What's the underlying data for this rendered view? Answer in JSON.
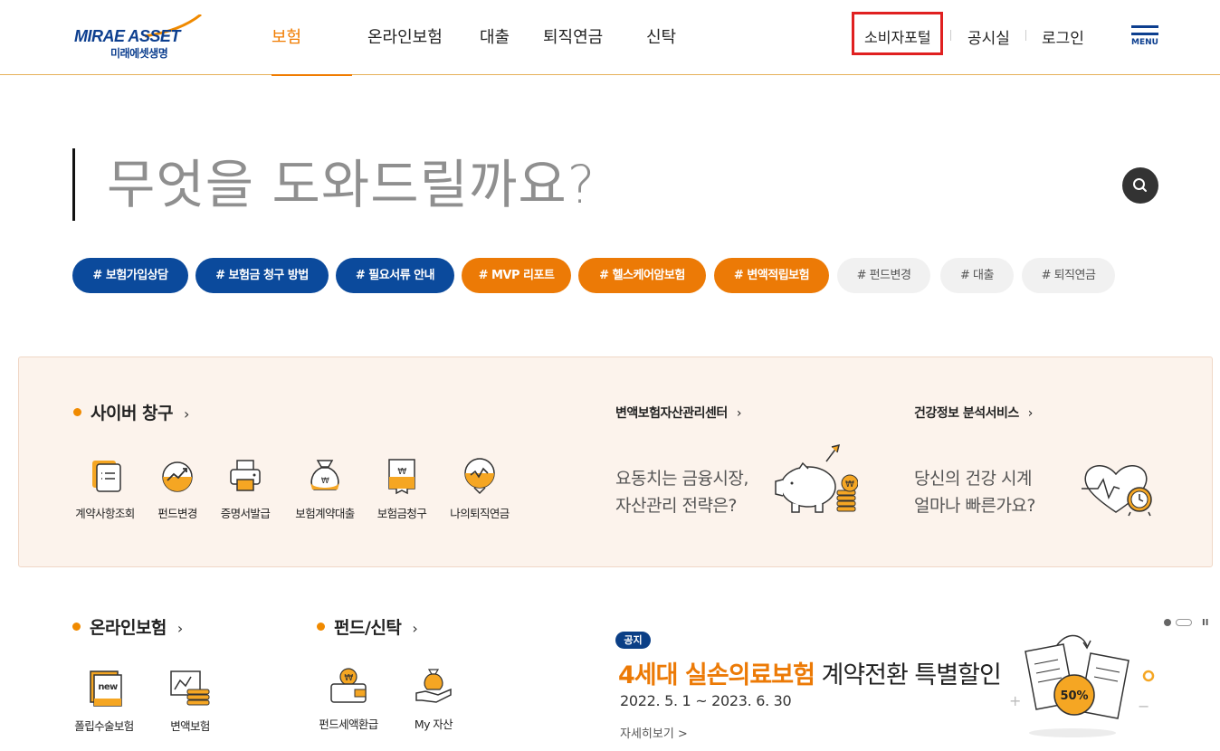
{
  "header": {
    "logo_brand": "MIRAE ASSET",
    "logo_sub": "미래에셋생명",
    "nav": [
      {
        "label": "보험",
        "active": true
      },
      {
        "label": "온라인보험",
        "active": false
      },
      {
        "label": "대출",
        "active": false
      },
      {
        "label": "퇴직연금",
        "active": false
      },
      {
        "label": "신탁",
        "active": false
      }
    ],
    "util": {
      "consumer": "소비자포털",
      "notice": "공시실",
      "login": "로그인"
    },
    "menu_label": "MENU"
  },
  "search": {
    "placeholder": "무엇을 도와드릴까요?"
  },
  "tags": [
    {
      "label": "# 보험가입상담",
      "style": "blue"
    },
    {
      "label": "# 보험금 청구 방법",
      "style": "blue"
    },
    {
      "label": "# 필요서류 안내",
      "style": "blue"
    },
    {
      "label": "# MVP 리포트",
      "style": "orange"
    },
    {
      "label": "# 헬스케어암보험",
      "style": "orange"
    },
    {
      "label": "# 변액적립보험",
      "style": "orange"
    },
    {
      "label": "# 펀드변경",
      "style": "gray"
    },
    {
      "label": "# 대출",
      "style": "gray"
    },
    {
      "label": "# 퇴직연금",
      "style": "gray"
    }
  ],
  "cyber": {
    "title": "사이버 창구",
    "services": [
      {
        "label": "계약사항조회",
        "icon": "contract-doc-icon"
      },
      {
        "label": "펀드변경",
        "icon": "fund-chart-icon"
      },
      {
        "label": "증명서발급",
        "icon": "printer-icon"
      },
      {
        "label": "보험계약대출",
        "icon": "money-bag-icon"
      },
      {
        "label": "보험금청구",
        "icon": "claim-doc-icon"
      },
      {
        "label": "나의퇴직연금",
        "icon": "pension-chart-icon"
      }
    ],
    "asset_center": {
      "title": "변액보험자산관리센터",
      "text_line1": "요동치는 금융시장,",
      "text_line2": "자산관리 전략은?"
    },
    "health": {
      "title": "건강정보 분석서비스",
      "text_line1": "당신의 건강 시계",
      "text_line2": "얼마나 빠른가요?"
    }
  },
  "online": {
    "title": "온라인보험",
    "services": [
      {
        "label": "폴립수술보험",
        "icon": "new-book-icon"
      },
      {
        "label": "변액보험",
        "icon": "chart-coins-icon"
      }
    ]
  },
  "fund": {
    "title": "펀드/신탁",
    "services": [
      {
        "label": "펀드세액환급",
        "icon": "wallet-icon"
      },
      {
        "label": "My 자산",
        "icon": "hand-money-icon"
      }
    ]
  },
  "notice": {
    "badge": "공지",
    "title_highlight": "4세대 실손의료보험",
    "title_rest": " 계약전환 특별할인",
    "date": "2022. 5. 1 ~ 2023. 6. 30",
    "more": "자세히보기 >",
    "discount": "50%"
  },
  "colors": {
    "brand_blue": "#0b4a9c",
    "brand_orange": "#ec7a06",
    "highlight_red": "#e02020"
  }
}
